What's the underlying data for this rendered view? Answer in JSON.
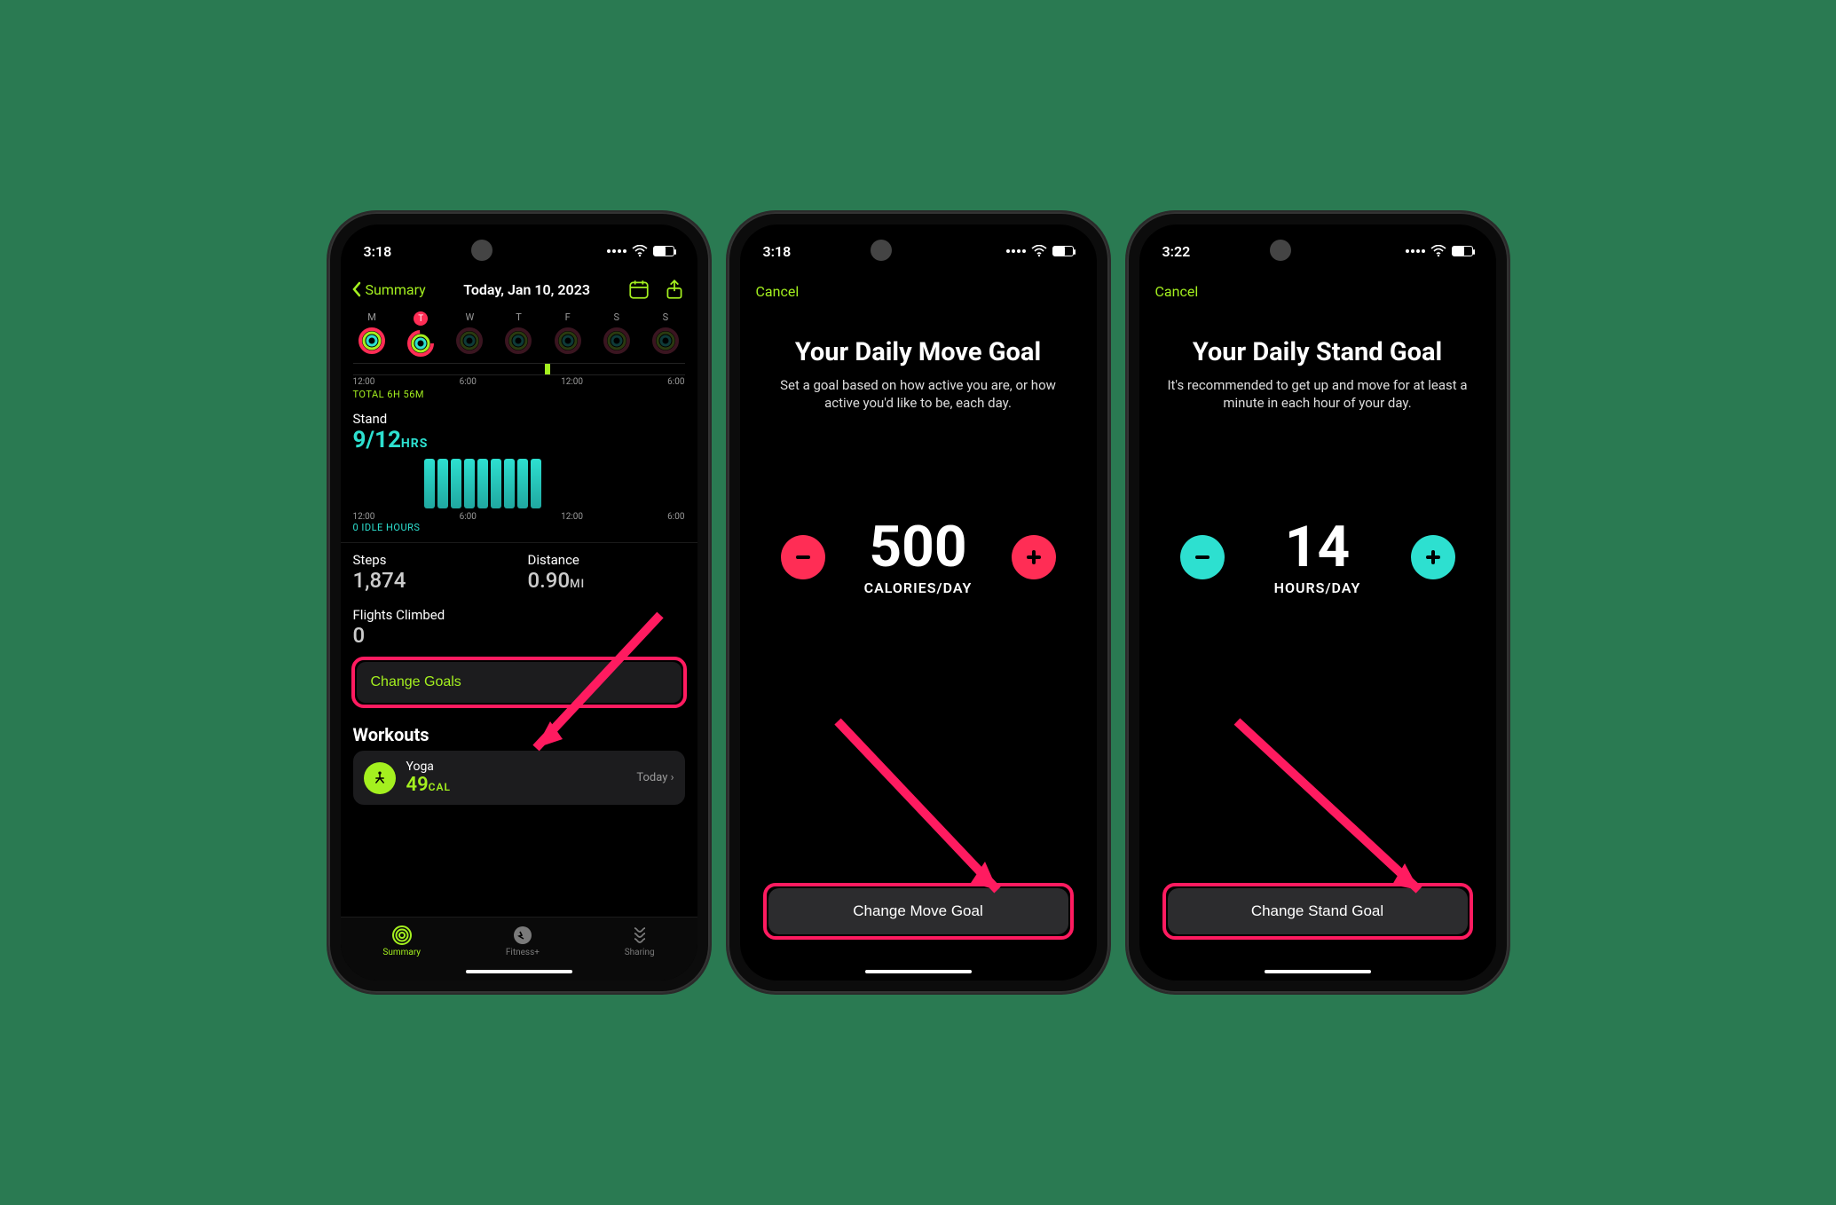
{
  "phone1": {
    "status": {
      "time": "3:18"
    },
    "nav": {
      "back_label": "Summary",
      "title": "Today, Jan 10, 2023"
    },
    "days": [
      {
        "label": "M"
      },
      {
        "label": "T"
      },
      {
        "label": "W"
      },
      {
        "label": "T"
      },
      {
        "label": "F"
      },
      {
        "label": "S"
      },
      {
        "label": "S"
      }
    ],
    "timeline": {
      "labels": [
        "12:00",
        "6:00",
        "12:00",
        "6:00"
      ],
      "total": "TOTAL 6H 56M"
    },
    "stand": {
      "title": "Stand",
      "value": "9/12",
      "unit": "HRS",
      "labels": [
        "12:00",
        "6:00",
        "12:00",
        "6:00"
      ],
      "idle": "0 IDLE HOURS"
    },
    "steps": {
      "label": "Steps",
      "value": "1,874"
    },
    "distance": {
      "label": "Distance",
      "value": "0.90",
      "unit": "MI"
    },
    "flights": {
      "label": "Flights Climbed",
      "value": "0"
    },
    "change_goals_label": "Change Goals",
    "workouts": {
      "header": "Workouts",
      "item": {
        "name": "Yoga",
        "cal": "49",
        "unit": "CAL",
        "date": "Today"
      }
    },
    "tabs": {
      "summary": "Summary",
      "fitnessplus": "Fitness+",
      "sharing": "Sharing"
    }
  },
  "phone2": {
    "status": {
      "time": "3:18"
    },
    "cancel": "Cancel",
    "title": "Your Daily Move Goal",
    "subtitle": "Set a goal based on how active you are, or how active you'd like to be, each day.",
    "value": "500",
    "unit": "CALORIES/DAY",
    "action": "Change Move Goal"
  },
  "phone3": {
    "status": {
      "time": "3:22"
    },
    "cancel": "Cancel",
    "title": "Your Daily Stand Goal",
    "subtitle": "It's recommended to get up and move for at least a minute in each hour of your day.",
    "value": "14",
    "unit": "HOURS/DAY",
    "action": "Change Stand Goal"
  }
}
